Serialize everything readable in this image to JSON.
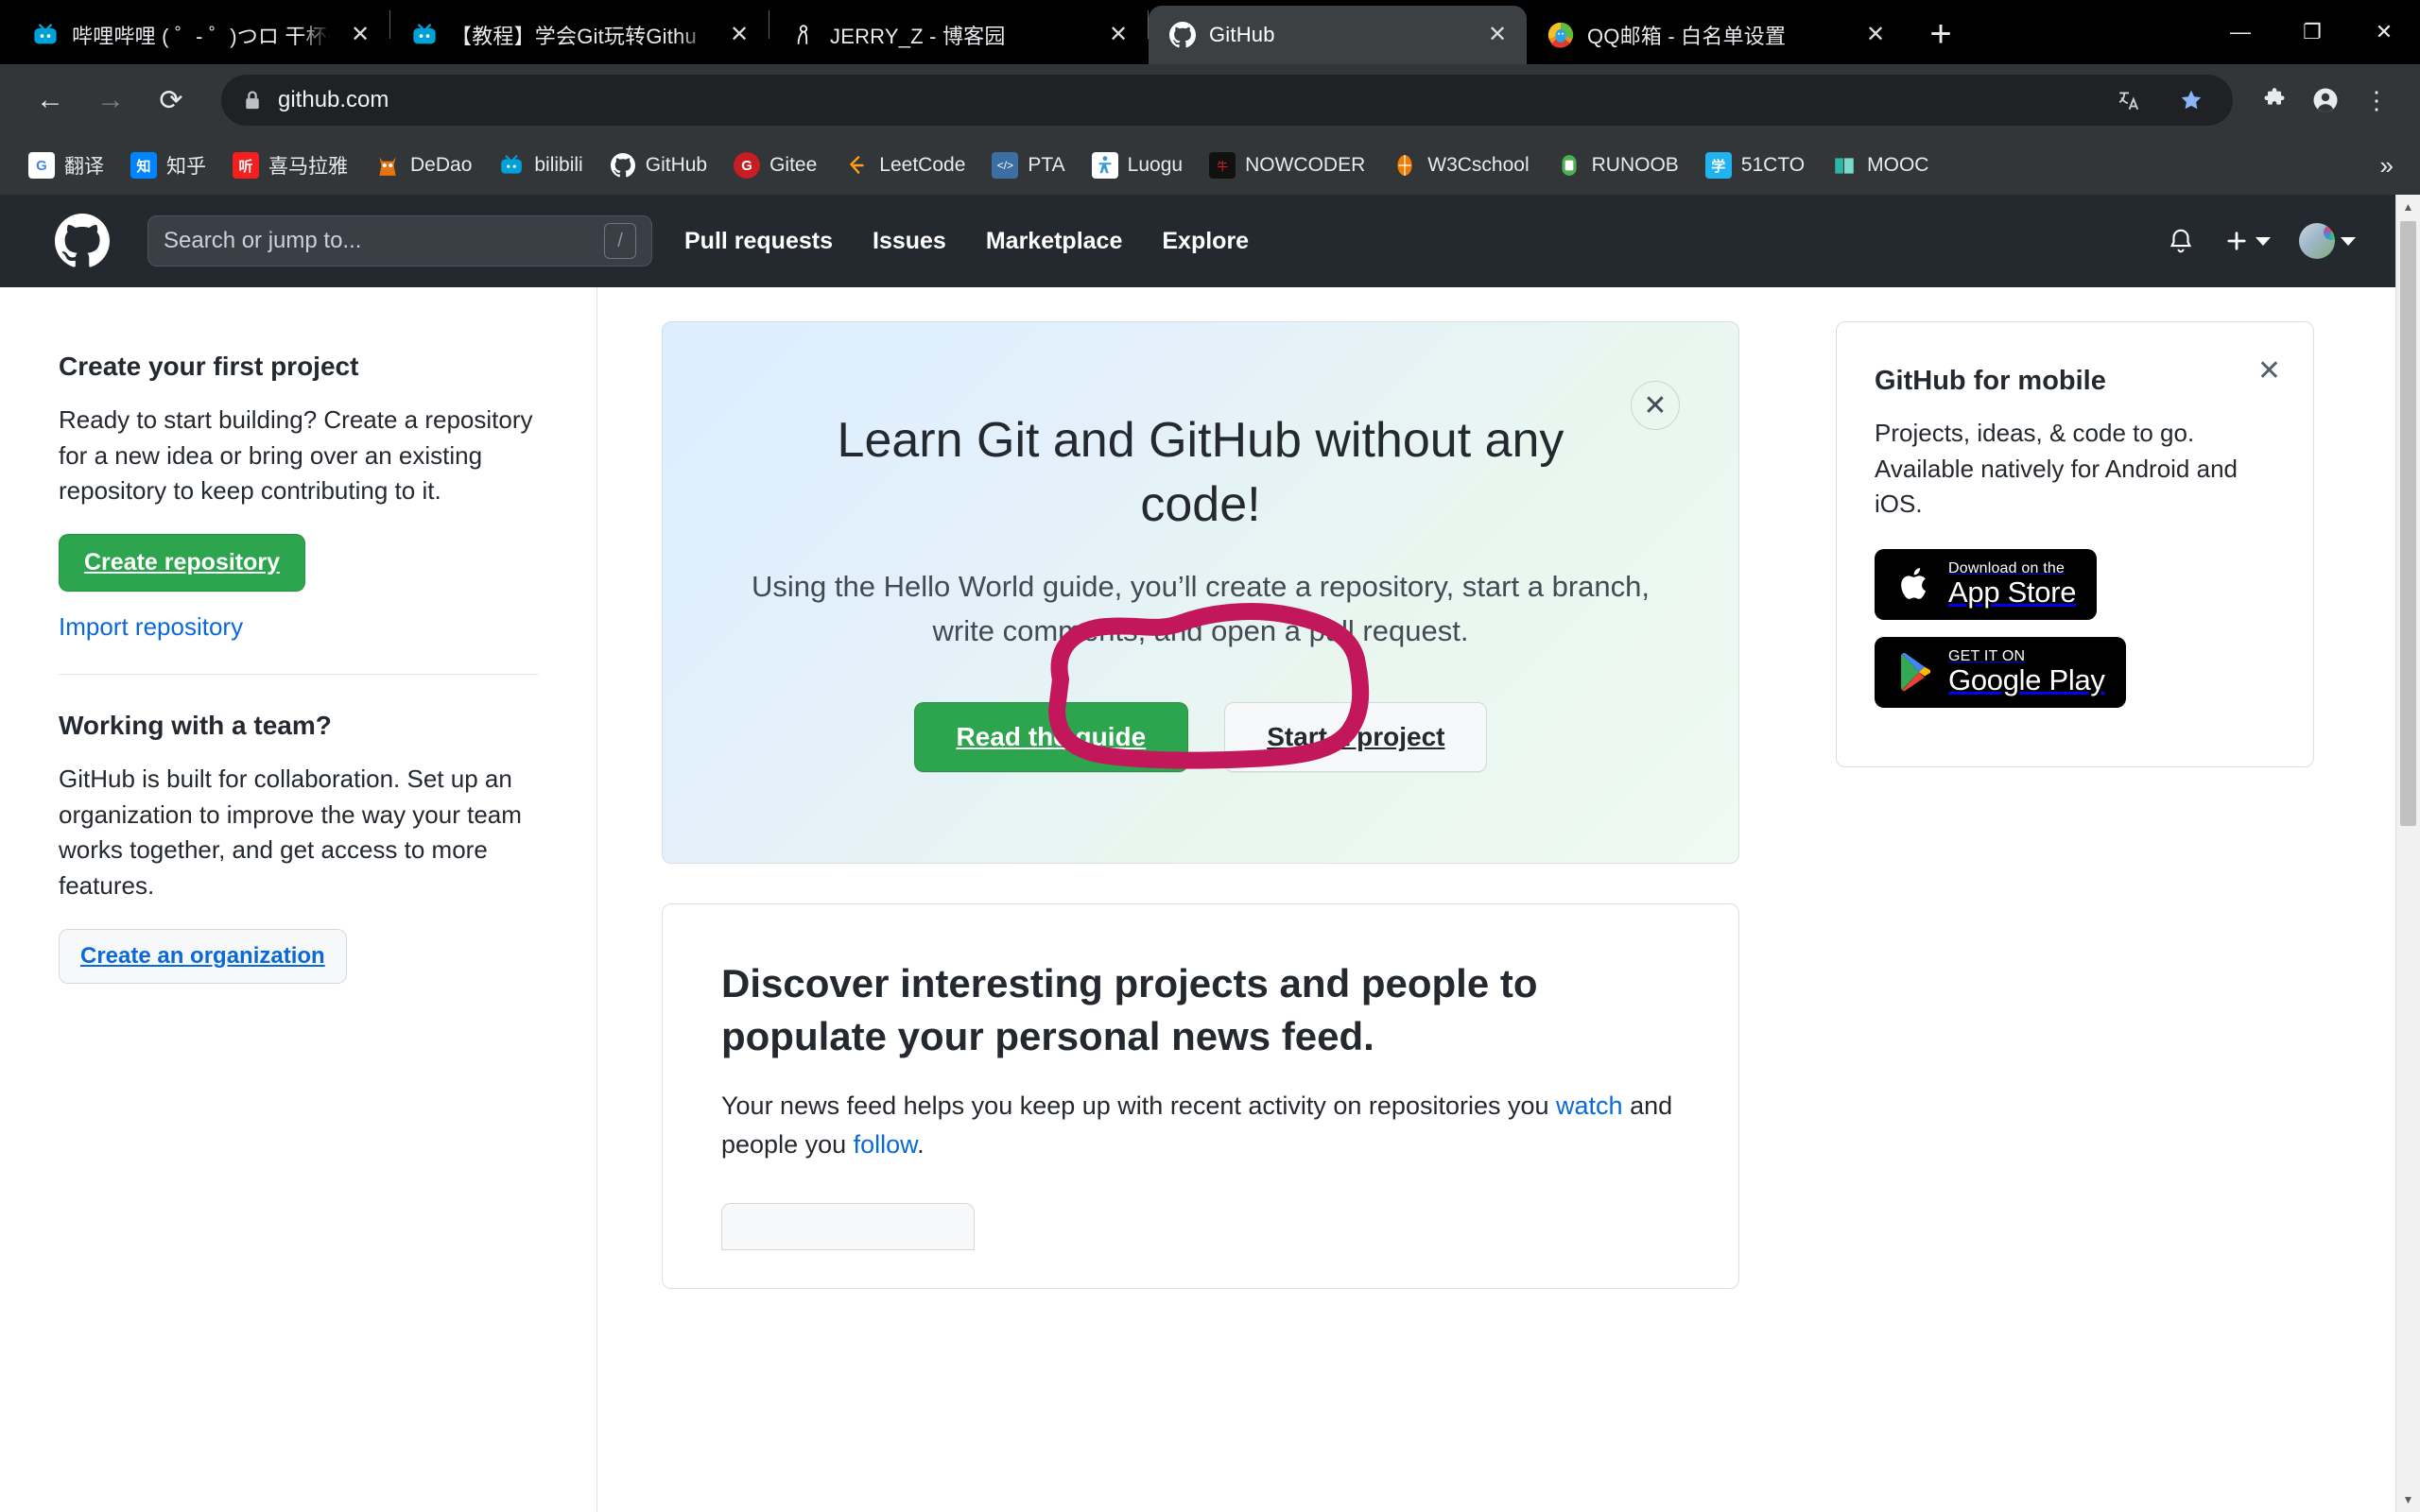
{
  "browser": {
    "tabs": [
      {
        "title": "哔哩哔哩 ( ゜- ゜)つロ 干杯~",
        "favicon": "bilibili-icon",
        "active": false
      },
      {
        "title": "【教程】学会Git玩转Githu",
        "favicon": "bilibili-icon",
        "active": false
      },
      {
        "title": "JERRY_Z - 博客园",
        "favicon": "cnblogs-icon",
        "active": false
      },
      {
        "title": "GitHub",
        "favicon": "github-icon",
        "active": true
      },
      {
        "title": "QQ邮箱 - 白名单设置",
        "favicon": "qqmail-icon",
        "active": false
      }
    ],
    "new_tab_label": "+",
    "window_controls": {
      "minimize": "—",
      "maximize": "❐",
      "close": "✕"
    },
    "nav": {
      "back": "←",
      "forward": "→",
      "reload": "⟳"
    },
    "address": {
      "url": "github.com",
      "lock_icon": "lock-icon"
    },
    "toolbar_icons": [
      "translate-icon",
      "bookmark-star-icon",
      "extensions-icon",
      "profile-icon",
      "more-menu-icon"
    ],
    "bookmarks": [
      {
        "label": "翻译",
        "icon": "google-translate-icon",
        "color": "#4285f4",
        "glyph": "G"
      },
      {
        "label": "知乎",
        "icon": "zhihu-icon",
        "color": "#0084ff",
        "glyph": "知"
      },
      {
        "label": "喜马拉雅",
        "icon": "ximalaya-icon",
        "color": "#f42020",
        "glyph": "听"
      },
      {
        "label": "DeDao",
        "icon": "dedao-icon",
        "color": "#e8730c",
        "glyph": "🦉"
      },
      {
        "label": "bilibili",
        "icon": "bilibili-icon",
        "color": "#00a1d6",
        "glyph": ""
      },
      {
        "label": "GitHub",
        "icon": "github-icon",
        "color": "#ffffff",
        "glyph": ""
      },
      {
        "label": "Gitee",
        "icon": "gitee-icon",
        "color": "#c71d23",
        "glyph": "G"
      },
      {
        "label": "LeetCode",
        "icon": "leetcode-icon",
        "color": "#ffa116",
        "glyph": ""
      },
      {
        "label": "PTA",
        "icon": "pta-icon",
        "color": "#3b6ea5",
        "glyph": ""
      },
      {
        "label": "Luogu",
        "icon": "luogu-icon",
        "color": "#3498db",
        "glyph": ""
      },
      {
        "label": "NOWCODER",
        "icon": "nowcoder-icon",
        "color": "#111111",
        "glyph": ""
      },
      {
        "label": "W3Cschool",
        "icon": "w3cschool-icon",
        "color": "#f07c00",
        "glyph": ""
      },
      {
        "label": "RUNOOB",
        "icon": "runoob-icon",
        "color": "#4caf50",
        "glyph": ""
      },
      {
        "label": "51CTO",
        "icon": "51cto-icon",
        "color": "#21b3f0",
        "glyph": "学"
      },
      {
        "label": "MOOC",
        "icon": "mooc-icon",
        "color": "#2db7a0",
        "glyph": ""
      }
    ],
    "bookmarks_overflow": "»"
  },
  "github": {
    "header": {
      "logo_icon": "github-mark-icon",
      "search_placeholder": "Search or jump to...",
      "search_value": "",
      "search_shortcut": "/",
      "nav": [
        {
          "label": "Pull requests"
        },
        {
          "label": "Issues"
        },
        {
          "label": "Marketplace"
        },
        {
          "label": "Explore"
        }
      ],
      "notifications_icon": "bell-icon",
      "create_new_icon": "plus-icon",
      "account_icon": "avatar"
    },
    "left_panel": {
      "section1": {
        "heading": "Create your first project",
        "body": "Ready to start building? Create a repository for a new idea or bring over an existing repository to keep contributing to it.",
        "primary_button": "Create repository",
        "secondary_link": "Import repository"
      },
      "section2": {
        "heading": "Working with a team?",
        "body": "GitHub is built for collaboration. Set up an organization to improve the way your team works together, and get access to more features.",
        "button": "Create an organization"
      }
    },
    "hero": {
      "title": "Learn Git and GitHub without any code!",
      "subtitle": "Using the Hello World guide, you’ll create a repository, start a branch, write comments, and open a pull request.",
      "primary_button": "Read the guide",
      "secondary_button": "Start a project",
      "close_icon": "close-icon",
      "annotation": {
        "type": "hand-drawn-circle",
        "color": "#c2185b",
        "targets": "Start a project"
      }
    },
    "feed_card": {
      "heading": "Discover interesting projects and people to populate your personal news feed.",
      "body_prefix": "Your news feed helps you keep up with recent activity on repositories you ",
      "link1": "watch",
      "body_middle": " and people you ",
      "link2": "follow",
      "body_suffix": "."
    },
    "mobile_card": {
      "heading": "GitHub for mobile",
      "body": "Projects, ideas, & code to go. Available natively for Android and iOS.",
      "close_icon": "close-icon",
      "app_store": {
        "small": "Download on the",
        "big": "App Store",
        "icon": "apple-icon"
      },
      "google_play": {
        "small": "GET IT ON",
        "big": "Google Play",
        "icon": "google-play-icon"
      }
    }
  },
  "colors": {
    "chrome_dark": "#323639",
    "tabstrip_black": "#000000",
    "github_header": "#24292f",
    "github_green": "#2da44e",
    "github_link_blue": "#0969da",
    "annotation_pink": "#c2185b"
  }
}
